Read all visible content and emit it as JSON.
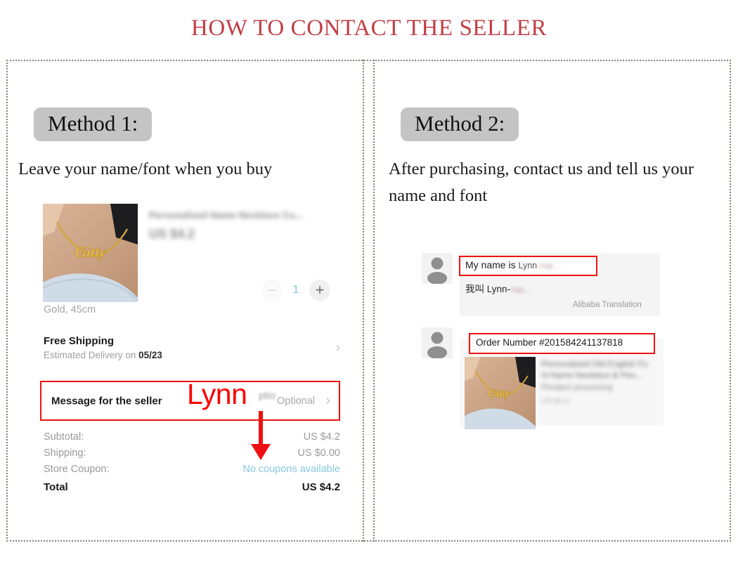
{
  "title": "HOW TO CONTACT THE SELLER",
  "theme": {
    "title_color": "#c13f45",
    "badge_bg": "#c4c4c4",
    "highlight_red": "#ee1111",
    "annotation_red": "#ff0000",
    "frame_color": "#8a7f72",
    "link_blue": "#86c8e0"
  },
  "method1": {
    "badge": "Method 1:",
    "description": "Leave your name/font when you buy",
    "checkout": {
      "product_title_blurred": "Personalized Name Necklace Cu...",
      "product_price_blurred": "US $4.2",
      "product_photo_alt": "gold name necklace reading Gitty on a neck",
      "necklace_name": "Gitty",
      "quantity": {
        "minus": "−",
        "value": "1",
        "plus": "+"
      },
      "variant": "Gold, 45cm",
      "shipping_title": "Free Shipping",
      "shipping_sub_prefix": "Estimated Delivery on ",
      "shipping_date": "05/23",
      "message_row": {
        "label": "Message for the seller",
        "value": "Optional",
        "chevron": "›"
      },
      "totals": [
        {
          "label": "Subtotal:",
          "value": "US $4.2",
          "style": "normal"
        },
        {
          "label": "Shipping:",
          "value": "US $0.00",
          "style": "normal"
        },
        {
          "label": "Store Coupon:",
          "value": "No coupons available",
          "style": "coupon"
        },
        {
          "label": "Total",
          "value": "US $4.2",
          "style": "final"
        }
      ],
      "annotation_name": "Lynn",
      "annotation_blur_text": "ptio"
    }
  },
  "method2": {
    "badge": "Method 2:",
    "description": "After purchasing, contact us and tell us your name and font",
    "chat": {
      "message1": {
        "english_lead": "My name is ",
        "english_name": "Lynn",
        "english_blur": "-nsp...",
        "chinese": "我叫  Lynn-",
        "chinese_blur": "nsp...",
        "translation_note": "Alibaba Translation"
      },
      "message2": {
        "order_label": "Order Number #201584241137818",
        "photo_alt": "gold name necklace reading Gitty on a neck",
        "necklace_name": "Gitty",
        "card_line1_blurred": "Personalized Old English Fo",
        "card_line2_blurred": "nt Name Necklace & Pen...",
        "card_line3_blurred": "Pendant processing",
        "card_line4_blurred": "US $4.2"
      }
    }
  }
}
